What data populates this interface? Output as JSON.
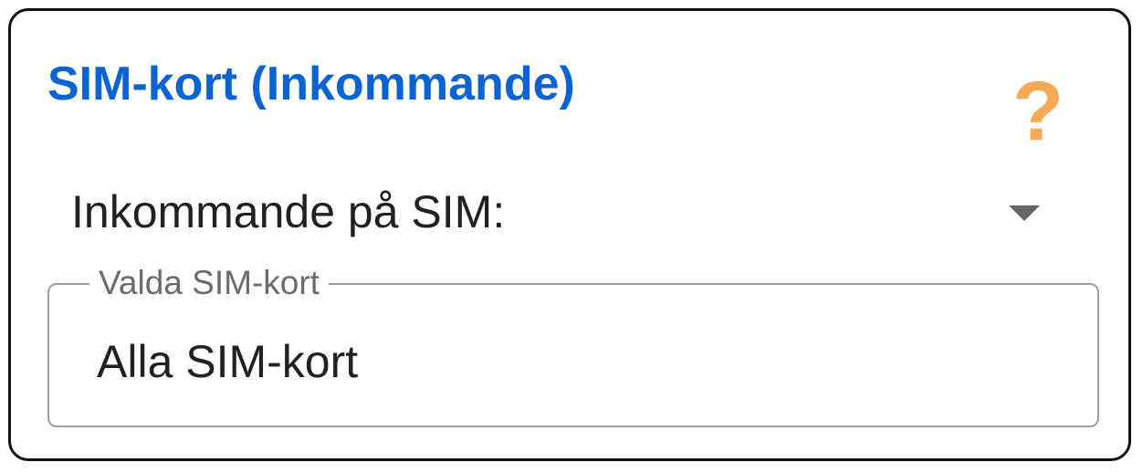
{
  "card": {
    "title": "SIM-kort (Inkommande)",
    "help_icon": "question-mark-icon",
    "help_glyph": "?"
  },
  "select": {
    "label": "Inkommande på SIM:",
    "arrow_icon": "triangle-down-icon"
  },
  "selected_sims": {
    "legend": "Valda SIM-kort",
    "value": "Alla SIM-kort"
  },
  "colors": {
    "title": "#0a63d2",
    "help_icon": "#f7a857",
    "border": "#111111",
    "field_border": "#9e9e9e"
  }
}
